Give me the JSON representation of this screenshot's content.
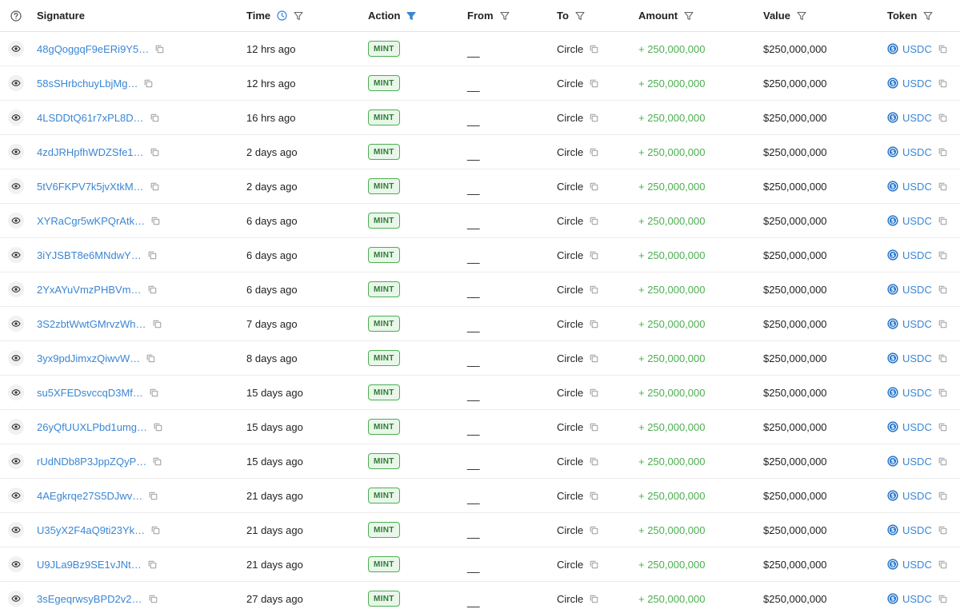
{
  "header": {
    "signature": "Signature",
    "time": "Time",
    "action": "Action",
    "from": "From",
    "to": "To",
    "amount": "Amount",
    "value": "Value",
    "token": "Token"
  },
  "colors": {
    "link": "#3a86d4",
    "positive": "#4caf50",
    "badge_border": "#4caf50",
    "badge_bg": "#e9f6ea",
    "active_filter": "#3a86d4"
  },
  "icons": {
    "help": "help-icon",
    "clock": "clock-icon",
    "filter": "filter-icon",
    "eye": "eye-icon",
    "copy": "copy-icon",
    "token_logo": "usdc-logo-icon"
  },
  "rows": [
    {
      "signature": "48gQoggqF9eERi9Y5…",
      "time": "12 hrs ago",
      "action": "MINT",
      "from": "__",
      "to": "Circle",
      "amount": "+ 250,000,000",
      "value": "$250,000,000",
      "token": "USDC"
    },
    {
      "signature": "58sSHrbchuyLbjMg…",
      "time": "12 hrs ago",
      "action": "MINT",
      "from": "__",
      "to": "Circle",
      "amount": "+ 250,000,000",
      "value": "$250,000,000",
      "token": "USDC"
    },
    {
      "signature": "4LSDDtQ61r7xPL8D…",
      "time": "16 hrs ago",
      "action": "MINT",
      "from": "__",
      "to": "Circle",
      "amount": "+ 250,000,000",
      "value": "$250,000,000",
      "token": "USDC"
    },
    {
      "signature": "4zdJRHpfhWDZSfe1…",
      "time": "2 days ago",
      "action": "MINT",
      "from": "__",
      "to": "Circle",
      "amount": "+ 250,000,000",
      "value": "$250,000,000",
      "token": "USDC"
    },
    {
      "signature": "5tV6FKPV7k5jvXtkM…",
      "time": "2 days ago",
      "action": "MINT",
      "from": "__",
      "to": "Circle",
      "amount": "+ 250,000,000",
      "value": "$250,000,000",
      "token": "USDC"
    },
    {
      "signature": "XYRaCgr5wKPQrAtk…",
      "time": "6 days ago",
      "action": "MINT",
      "from": "__",
      "to": "Circle",
      "amount": "+ 250,000,000",
      "value": "$250,000,000",
      "token": "USDC"
    },
    {
      "signature": "3iYJSBT8e6MNdwY…",
      "time": "6 days ago",
      "action": "MINT",
      "from": "__",
      "to": "Circle",
      "amount": "+ 250,000,000",
      "value": "$250,000,000",
      "token": "USDC"
    },
    {
      "signature": "2YxAYuVmzPHBVm…",
      "time": "6 days ago",
      "action": "MINT",
      "from": "__",
      "to": "Circle",
      "amount": "+ 250,000,000",
      "value": "$250,000,000",
      "token": "USDC"
    },
    {
      "signature": "3S2zbtWwtGMrvzWh…",
      "time": "7 days ago",
      "action": "MINT",
      "from": "__",
      "to": "Circle",
      "amount": "+ 250,000,000",
      "value": "$250,000,000",
      "token": "USDC"
    },
    {
      "signature": "3yx9pdJimxzQiwvW…",
      "time": "8 days ago",
      "action": "MINT",
      "from": "__",
      "to": "Circle",
      "amount": "+ 250,000,000",
      "value": "$250,000,000",
      "token": "USDC"
    },
    {
      "signature": "su5XFEDsvccqD3Mf…",
      "time": "15 days ago",
      "action": "MINT",
      "from": "__",
      "to": "Circle",
      "amount": "+ 250,000,000",
      "value": "$250,000,000",
      "token": "USDC"
    },
    {
      "signature": "26yQfUUXLPbd1umg…",
      "time": "15 days ago",
      "action": "MINT",
      "from": "__",
      "to": "Circle",
      "amount": "+ 250,000,000",
      "value": "$250,000,000",
      "token": "USDC"
    },
    {
      "signature": "rUdNDb8P3JppZQyP…",
      "time": "15 days ago",
      "action": "MINT",
      "from": "__",
      "to": "Circle",
      "amount": "+ 250,000,000",
      "value": "$250,000,000",
      "token": "USDC"
    },
    {
      "signature": "4AEgkrqe27S5DJwv…",
      "time": "21 days ago",
      "action": "MINT",
      "from": "__",
      "to": "Circle",
      "amount": "+ 250,000,000",
      "value": "$250,000,000",
      "token": "USDC"
    },
    {
      "signature": "U35yX2F4aQ9ti23Yk…",
      "time": "21 days ago",
      "action": "MINT",
      "from": "__",
      "to": "Circle",
      "amount": "+ 250,000,000",
      "value": "$250,000,000",
      "token": "USDC"
    },
    {
      "signature": "U9JLa9Bz9SE1vJNt…",
      "time": "21 days ago",
      "action": "MINT",
      "from": "__",
      "to": "Circle",
      "amount": "+ 250,000,000",
      "value": "$250,000,000",
      "token": "USDC"
    },
    {
      "signature": "3sEgeqrwsyBPD2v2…",
      "time": "27 days ago",
      "action": "MINT",
      "from": "__",
      "to": "Circle",
      "amount": "+ 250,000,000",
      "value": "$250,000,000",
      "token": "USDC"
    }
  ]
}
